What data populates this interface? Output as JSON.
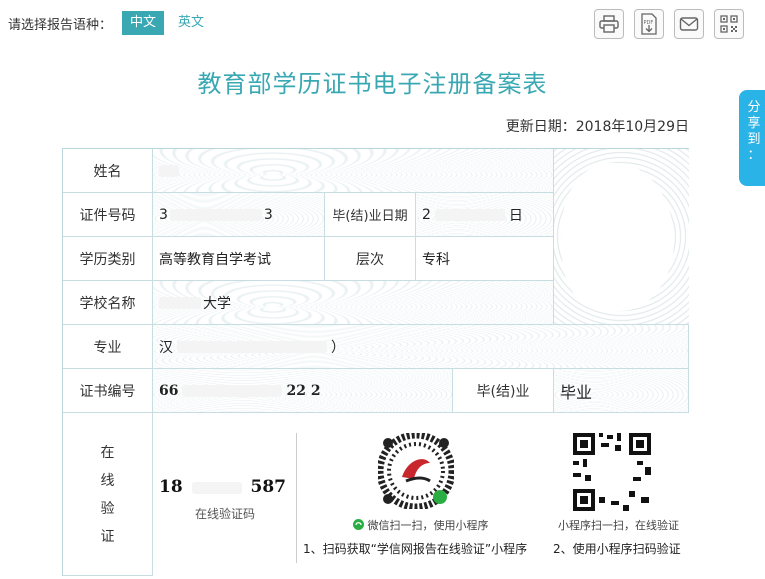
{
  "lang": {
    "label": "请选择报告语种：",
    "zh": "中文",
    "en": "英文"
  },
  "toolbar": {
    "print_icon": "printer-icon",
    "pdf_icon": "pdf-icon",
    "mail_icon": "mail-icon",
    "qr_icon": "qrcode-icon",
    "pdf_text": "PDF"
  },
  "title": "教育部学历证书电子注册备案表",
  "update": "更新日期：2018年10月29日",
  "share": [
    "分",
    "享",
    "到",
    "："
  ],
  "rows": {
    "name_label": "姓名",
    "id_label": "证件号码",
    "id_value_start": "3",
    "id_value_end": "3",
    "grad_date_label": "毕(结)业日期",
    "grad_date_start": "2",
    "grad_date_end": "日",
    "edu_type_label": "学历类别",
    "edu_type_value": "高等教育自学考试",
    "level_label": "层次",
    "level_value": "专科",
    "school_label": "学校名称",
    "school_value": "大学",
    "major_label": "专业",
    "major_start": "汉",
    "major_end": "）",
    "cert_label": "证书编号",
    "cert_start": "66",
    "cert_end": "22 2",
    "status_label": "毕(结)业",
    "status_value": "毕业",
    "verify_label": [
      "在",
      "线",
      "验",
      "证"
    ],
    "verify_code_start": "18",
    "verify_code_end": "587",
    "verify_code_label": "在线验证码",
    "wechat_caption": "微信扫一扫，使用小程序",
    "mini_caption": "小程序扫一扫，在线验证",
    "step1": "1、扫码获取“学信网报告在线验证”小程序",
    "step2": "2、使用小程序扫码验证"
  }
}
